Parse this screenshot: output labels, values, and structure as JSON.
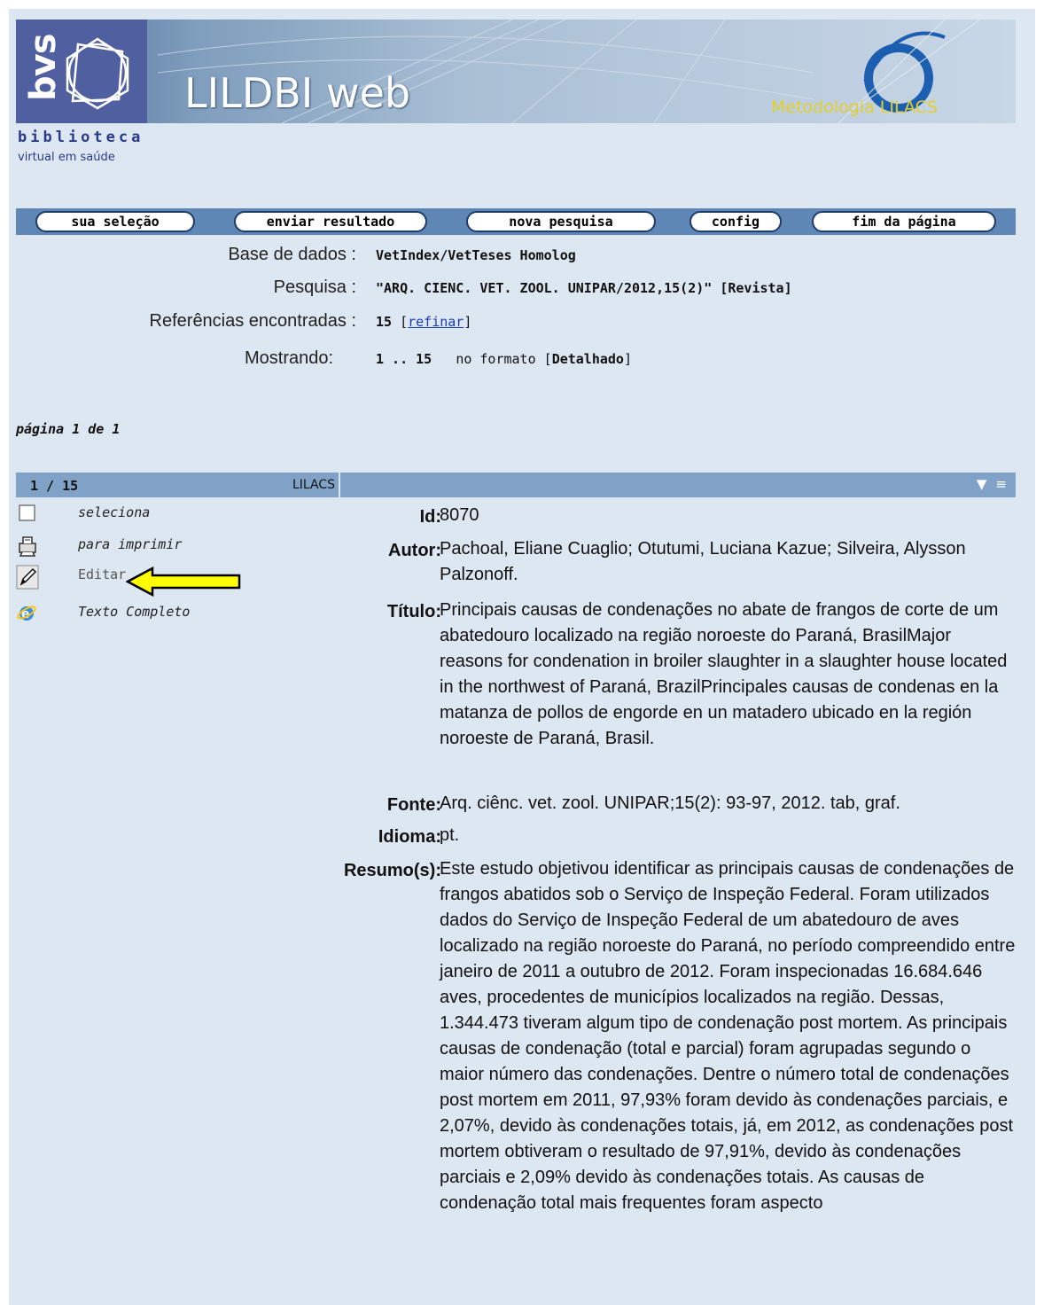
{
  "banner": {
    "bvs": "bvs",
    "title": "LILDBI web",
    "metodologia": "Metodologia LILACS",
    "biblioteca": "biblioteca",
    "virtual": "virtual em saúde"
  },
  "toolbar": {
    "sua_selecao": "sua seleção",
    "enviar_resultado": "enviar resultado",
    "nova_pesquisa": "nova pesquisa",
    "config": "config",
    "fim_da_pagina": "fim da página"
  },
  "query": {
    "base_label": "Base de dados :",
    "base_value": "VetIndex/VetTeses Homolog",
    "pesquisa_label": "Pesquisa :",
    "pesquisa_value": "\"ARQ. CIENC. VET. ZOOL. UNIPAR/2012,15(2)\" [Revista]",
    "refs_label": "Referências encontradas :",
    "refs_value": "15",
    "refinar": "refinar",
    "mostrando_label": "Mostrando:",
    "mostrando_value": "1 .. 15",
    "formato_text": "no formato",
    "formato_value": "Detalhado"
  },
  "pagination": {
    "text": "página 1 de 1"
  },
  "record": {
    "count": "1 / 15",
    "source": "LILACS",
    "actions": {
      "seleciona": "seleciona",
      "imprimir": "para imprimir",
      "editar": "Editar",
      "texto_completo": "Texto Completo"
    },
    "fields": {
      "id_label": "Id:",
      "id_value": "8070",
      "autor_label": "Autor:",
      "autor_value": "Pachoal, Eliane Cuaglio; Otutumi, Luciana Kazue; Silveira, Alysson Palzonoff.",
      "titulo_label": "Título:",
      "titulo_value": "Principais causas de condenações no abate de frangos de corte de um abatedouro localizado na região noroeste do Paraná, BrasilMajor reasons for condenation in broiler slaughter in a slaughter house located in the northwest of Paraná, BrazilPrincipales causas de condenas en la matanza de pollos de engorde en un matadero ubicado en la región noroeste de Paraná, Brasil.",
      "fonte_label": "Fonte:",
      "fonte_value": "Arq. ciênc. vet. zool. UNIPAR;15(2): 93-97, 2012. tab, graf.",
      "idioma_label": "Idioma:",
      "idioma_value": "pt.",
      "resumo_label": "Resumo(s):",
      "resumo_value": "Este estudo objetivou identificar as principais causas de condenações de frangos abatidos sob o Serviço de Inspeção Federal. Foram utilizados dados do Serviço de Inspeção Federal de um abatedouro de aves localizado na região noroeste do Paraná, no período compreendido entre janeiro de 2011 a outubro de 2012. Foram inspecionadas 16.684.646 aves, procedentes de municípios localizados na região. Dessas, 1.344.473 tiveram algum tipo de condenação post mortem. As principais causas de condenação (total e parcial) foram agrupadas segundo o maior número das condenações. Dentre o número total de condenações post mortem em 2011, 97,93% foram devido às condenações parciais, e 2,07%, devido às condenações totais, já, em 2012, as condenações post mortem obtiveram o resultado de 97,91%, devido às condenações parciais e 2,09% devido às condenações totais. As causas de condenação total mais frequentes foram aspecto"
    }
  },
  "colors": {
    "page_bg": "#dde7f1",
    "toolbar_bg": "#5e87b5",
    "record_header_bg": "#7fa2c6",
    "highlight_arrow": "#ffff00"
  },
  "icons": [
    "checkbox-icon",
    "printer-icon",
    "pencil-icon",
    "ie-browser-icon",
    "chevron-down-icon",
    "collapse-icon",
    "arrow-annotation-icon"
  ]
}
